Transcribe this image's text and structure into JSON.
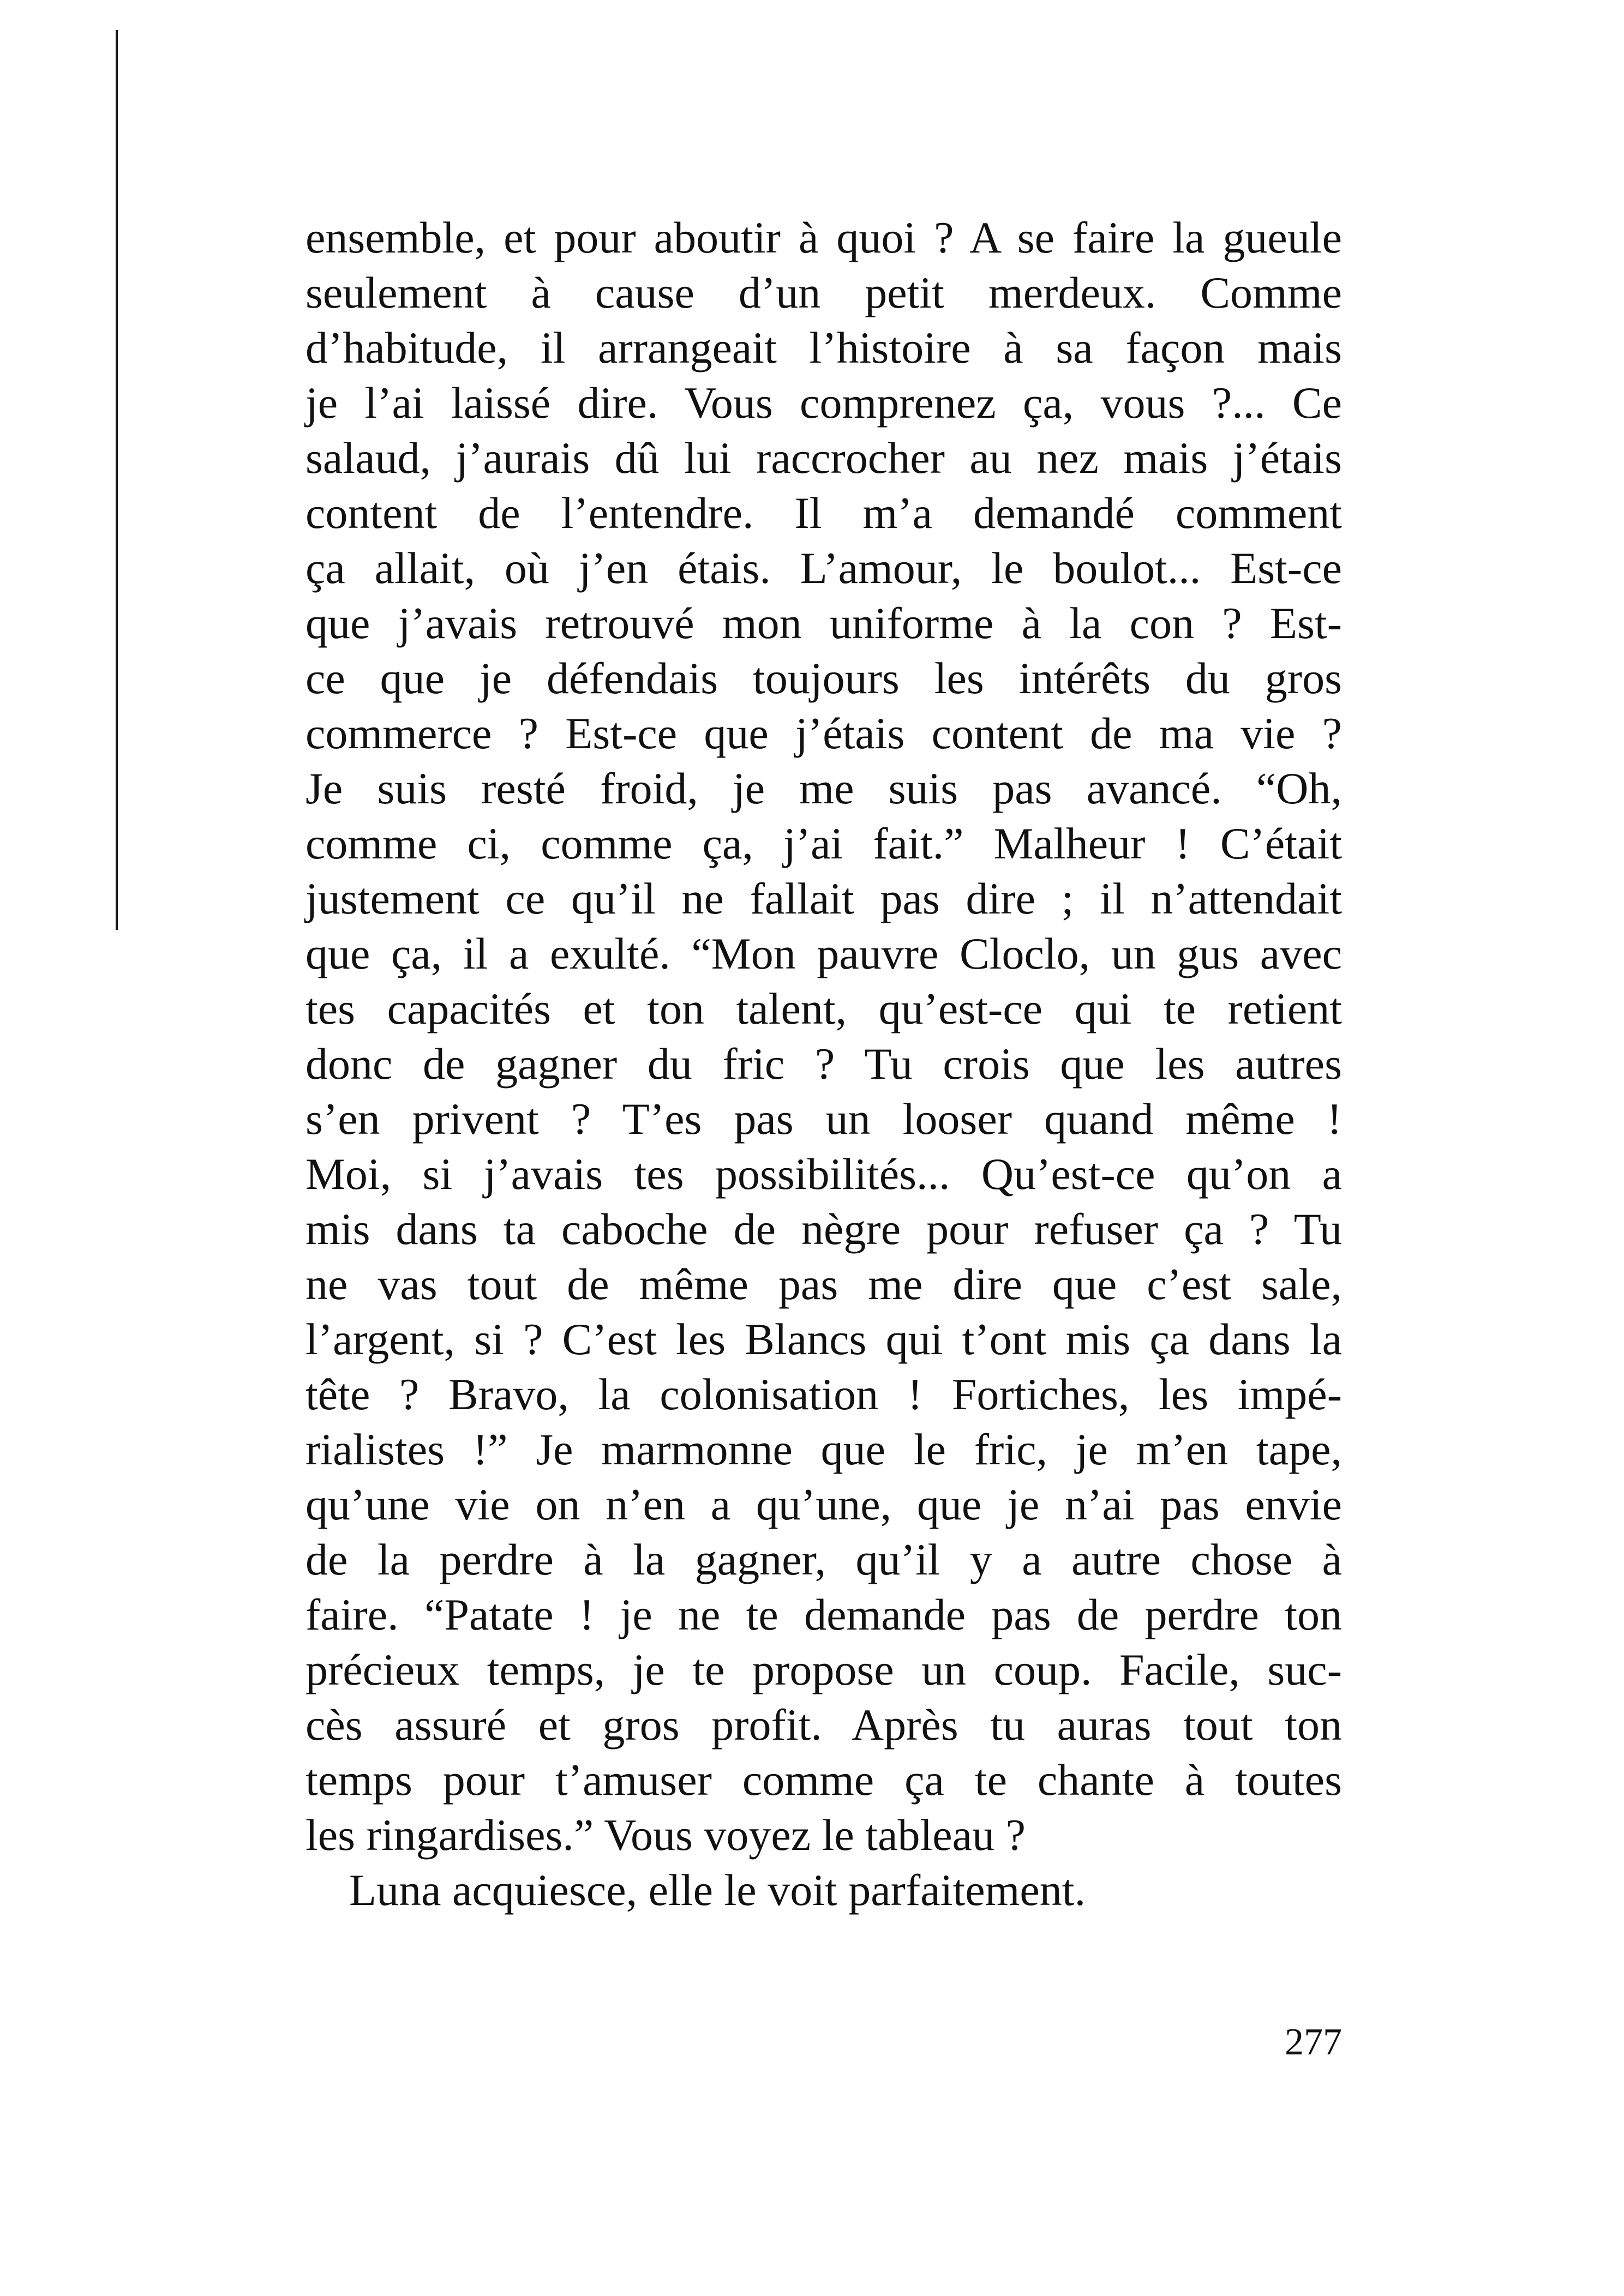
{
  "paragraph1": [
    "ensemble, et pour aboutir à quoi ? A se faire la gueule",
    "seulement à cause d’un petit merdeux. Comme",
    "d’habitude, il arrangeait l’histoire à sa façon mais",
    "je l’ai laissé dire. Vous comprenez ça, vous ?... Ce",
    "salaud, j’aurais dû lui raccrocher au nez mais j’étais",
    "content de l’entendre. Il m’a demandé comment",
    "ça allait, où j’en étais. L’amour, le boulot... Est-ce",
    "que j’avais retrouvé mon uniforme à la con ? Est-",
    "ce que je défendais toujours les intérêts du gros",
    "commerce ? Est-ce que j’étais content de ma vie ?",
    "Je suis resté froid, je me suis pas avancé. “Oh,",
    "comme ci, comme ça, j’ai fait.” Malheur ! C’était",
    "justement ce qu’il ne fallait pas dire ; il n’attendait",
    "que ça, il a exulté. “Mon pauvre Cloclo, un gus avec",
    "tes capacités et ton talent, qu’est-ce qui te retient",
    "donc de gagner du fric ? Tu crois que les autres",
    "s’en privent ? T’es pas un looser quand même !",
    "Moi, si j’avais tes possibilités... Qu’est-ce qu’on a",
    "mis dans ta caboche de nègre pour refuser ça ? Tu",
    "ne vas tout de même pas me dire que c’est sale,",
    "l’argent, si ? C’est les Blancs qui t’ont mis ça dans la",
    "tête ? Bravo, la colonisation ! Fortiches, les impé-",
    "rialistes !” Je marmonne que le fric, je m’en tape,",
    "qu’une vie on n’en a qu’une, que je n’ai pas envie",
    "de la perdre à la gagner, qu’il y a autre chose à",
    "faire. “Patate ! je ne te demande pas de perdre ton",
    "précieux temps, je te propose un coup. Facile, suc-",
    "cès assuré et gros profit. Après tu auras tout ton",
    "temps pour t’amuser comme ça te chante à toutes",
    "les ringardises.” Vous voyez le tableau ?"
  ],
  "paragraph2": "Luna acquiesce, elle le voit parfaitement.",
  "page_number": "277"
}
